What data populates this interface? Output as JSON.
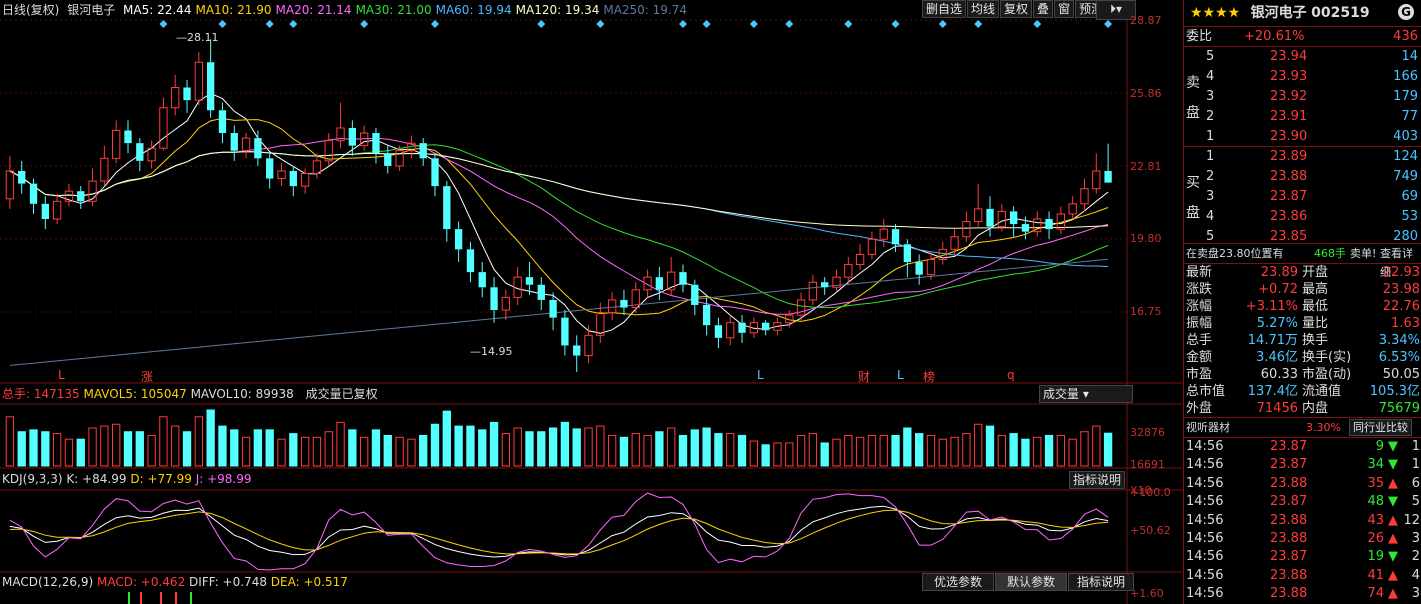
{
  "stock": {
    "stars": "★★★★",
    "name": "银河电子",
    "code": "002519"
  },
  "main_legend": {
    "title": "日线(复权)",
    "name": "银河电子",
    "ma": [
      {
        "label": "MA5: 22.44",
        "color": "#ffffff"
      },
      {
        "label": "MA10: 21.90",
        "color": "#ffd200"
      },
      {
        "label": "MA20: 21.14",
        "color": "#ff66ff"
      },
      {
        "label": "MA30: 21.00",
        "color": "#33dd33"
      },
      {
        "label": "MA60: 19.94",
        "color": "#4cb8ff"
      },
      {
        "label": "MA120: 19.34",
        "color": "#ffffcc"
      },
      {
        "label": "MA250: 19.74",
        "color": "#5a7a99"
      }
    ]
  },
  "toolbar": [
    {
      "label": "删自选"
    },
    {
      "label": "均线"
    },
    {
      "label": "复权"
    },
    {
      "label": "叠"
    },
    {
      "label": "窗"
    },
    {
      "label": "预测"
    }
  ],
  "price_axis": [
    "28.87",
    "25.86",
    "22.81",
    "19.80",
    "16.75"
  ],
  "annotations": {
    "high": "28.11",
    "low": "14.95"
  },
  "event_markers": [
    {
      "label": "L",
      "color": "#ff3b3b"
    },
    {
      "label": "涨",
      "color": "#ff3b3b"
    },
    {
      "label": "L",
      "color": "#4cc6ff"
    },
    {
      "label": "财",
      "color": "#ff3b3b"
    },
    {
      "label": "L",
      "color": "#4cc6ff"
    },
    {
      "label": "榜",
      "color": "#ff3b3b"
    },
    {
      "label": "q",
      "color": "#ff3b3b"
    }
  ],
  "volume_legend": {
    "total": "总手: 147135",
    "mavol5": "MAVOL5: 105047",
    "mavol10": "MAVOL10: 89938",
    "note": "成交量已复权",
    "button": "成交量"
  },
  "volume_axis": [
    "32876",
    "16691",
    "X10"
  ],
  "kdj_legend": {
    "name": "KDJ(9,3,3)",
    "k": "K: +84.99",
    "d": "D: +77.99",
    "j": "J: +98.99",
    "button": "指标说明"
  },
  "kdj_axis": [
    "+100.0",
    "+50.62"
  ],
  "macd_legend": {
    "name": "MACD(12,26,9)",
    "macd": "MACD: +0.462",
    "diff": "DIFF: +0.748",
    "dea": "DEA: +0.517",
    "buttons": [
      "优选参数",
      "默认参数",
      "指标说明"
    ]
  },
  "macd_axis": [
    "+1.60"
  ],
  "quote": {
    "weibi_label": "委比",
    "weibi_value": "+20.61%",
    "weibi_diff": "436",
    "sell_label": [
      "卖",
      "盘"
    ],
    "buy_label": [
      "买",
      "盘"
    ],
    "sell": [
      {
        "lvl": "5",
        "price": "23.94",
        "vol": "14"
      },
      {
        "lvl": "4",
        "price": "23.93",
        "vol": "166"
      },
      {
        "lvl": "3",
        "price": "23.92",
        "vol": "179"
      },
      {
        "lvl": "2",
        "price": "23.91",
        "vol": "77"
      },
      {
        "lvl": "1",
        "price": "23.90",
        "vol": "403"
      }
    ],
    "buy": [
      {
        "lvl": "1",
        "price": "23.89",
        "vol": "124"
      },
      {
        "lvl": "2",
        "price": "23.88",
        "vol": "749"
      },
      {
        "lvl": "3",
        "price": "23.87",
        "vol": "69"
      },
      {
        "lvl": "4",
        "price": "23.86",
        "vol": "53"
      },
      {
        "lvl": "5",
        "price": "23.85",
        "vol": "280"
      }
    ],
    "notice_a": "在卖盘23.80位置有",
    "notice_b": "468手",
    "notice_c": "卖单!",
    "notice_link": "查看详细",
    "stats": [
      {
        "l1": "最新",
        "v1": "23.89",
        "c1": "red",
        "l2": "开盘",
        "v2": "22.93",
        "c2": "red"
      },
      {
        "l1": "涨跌",
        "v1": "+0.72",
        "c1": "red",
        "l2": "最高",
        "v2": "23.98",
        "c2": "red"
      },
      {
        "l1": "涨幅",
        "v1": "+3.11%",
        "c1": "red",
        "l2": "最低",
        "v2": "22.76",
        "c2": "red"
      },
      {
        "l1": "振幅",
        "v1": "5.27%",
        "c1": "cyan",
        "l2": "量比",
        "v2": "1.63",
        "c2": "red"
      },
      {
        "l1": "总手",
        "v1": "14.71万",
        "c1": "cyan",
        "l2": "换手",
        "v2": "3.34%",
        "c2": "cyan"
      },
      {
        "l1": "金额",
        "v1": "3.46亿",
        "c1": "cyan",
        "l2": "换手(实)",
        "v2": "6.53%",
        "c2": "cyan"
      },
      {
        "l1": "市盈",
        "v1": "60.33",
        "c1": "white",
        "l2": "市盈(动)",
        "v2": "50.05",
        "c2": "white"
      },
      {
        "l1": "总市值",
        "v1": "137.4亿",
        "c1": "cyan",
        "l2": "流通值",
        "v2": "105.3亿",
        "c2": "cyan"
      },
      {
        "l1": "外盘",
        "v1": "71456",
        "c1": "red",
        "l2": "内盘",
        "v2": "75679",
        "c2": "green"
      }
    ],
    "industry": {
      "name": "视听器材",
      "pct": "3.30%",
      "button": "同行业比较"
    },
    "ticks": [
      {
        "time": "14:56",
        "price": "23.87",
        "vol": "9",
        "dir": "down",
        "n": "1"
      },
      {
        "time": "14:56",
        "price": "23.87",
        "vol": "34",
        "dir": "down",
        "n": "1"
      },
      {
        "time": "14:56",
        "price": "23.88",
        "vol": "35",
        "dir": "up",
        "n": "6"
      },
      {
        "time": "14:56",
        "price": "23.87",
        "vol": "48",
        "dir": "down",
        "n": "5"
      },
      {
        "time": "14:56",
        "price": "23.88",
        "vol": "43",
        "dir": "up",
        "n": "12"
      },
      {
        "time": "14:56",
        "price": "23.88",
        "vol": "26",
        "dir": "up",
        "n": "3"
      },
      {
        "time": "14:56",
        "price": "23.87",
        "vol": "19",
        "dir": "down",
        "n": "2"
      },
      {
        "time": "14:56",
        "price": "23.88",
        "vol": "41",
        "dir": "up",
        "n": "4"
      },
      {
        "time": "14:56",
        "price": "23.88",
        "vol": "74",
        "dir": "up",
        "n": "3"
      }
    ]
  },
  "chart_data": {
    "type": "candlestick",
    "ylim": [
      14.95,
      28.87
    ],
    "candles": [
      [
        21.8,
        22.9,
        23.5,
        21.4
      ],
      [
        22.9,
        22.4,
        23.3,
        22.0
      ],
      [
        22.4,
        21.6,
        22.6,
        21.2
      ],
      [
        21.6,
        21.0,
        21.9,
        20.6
      ],
      [
        21.0,
        21.7,
        22.0,
        20.8
      ],
      [
        21.7,
        22.1,
        22.4,
        21.5
      ],
      [
        22.1,
        21.7,
        22.3,
        21.4
      ],
      [
        21.7,
        22.5,
        23.0,
        21.5
      ],
      [
        22.5,
        23.4,
        23.9,
        22.3
      ],
      [
        23.4,
        24.5,
        24.9,
        23.2
      ],
      [
        24.5,
        24.0,
        24.9,
        23.6
      ],
      [
        24.0,
        23.3,
        24.2,
        22.9
      ],
      [
        23.3,
        23.8,
        24.1,
        23.0
      ],
      [
        23.8,
        25.4,
        25.8,
        23.7
      ],
      [
        25.4,
        26.2,
        26.7,
        25.1
      ],
      [
        26.2,
        25.7,
        26.5,
        25.2
      ],
      [
        25.7,
        27.2,
        27.6,
        25.5
      ],
      [
        27.2,
        25.3,
        28.11,
        25.0
      ],
      [
        25.3,
        24.4,
        25.6,
        24.0
      ],
      [
        24.4,
        23.7,
        24.7,
        23.3
      ],
      [
        23.7,
        24.2,
        24.4,
        23.4
      ],
      [
        24.2,
        23.4,
        24.5,
        23.1
      ],
      [
        23.4,
        22.6,
        23.6,
        22.2
      ],
      [
        22.6,
        22.9,
        23.2,
        22.3
      ],
      [
        22.9,
        22.3,
        23.1,
        21.9
      ],
      [
        22.3,
        22.8,
        23.0,
        22.0
      ],
      [
        22.8,
        23.3,
        23.6,
        22.6
      ],
      [
        23.3,
        24.1,
        24.4,
        23.1
      ],
      [
        24.1,
        24.6,
        25.6,
        23.8
      ],
      [
        24.6,
        23.9,
        24.9,
        23.5
      ],
      [
        23.9,
        24.4,
        24.7,
        23.7
      ],
      [
        24.4,
        23.6,
        24.6,
        23.2
      ],
      [
        23.6,
        23.1,
        23.9,
        22.8
      ],
      [
        23.1,
        23.7,
        23.9,
        22.9
      ],
      [
        23.7,
        24.0,
        24.3,
        23.4
      ],
      [
        24.0,
        23.4,
        24.2,
        23.1
      ],
      [
        23.4,
        22.3,
        23.6,
        21.9
      ],
      [
        22.3,
        20.6,
        22.5,
        20.1
      ],
      [
        20.6,
        19.8,
        20.9,
        19.3
      ],
      [
        19.8,
        18.9,
        20.1,
        18.5
      ],
      [
        18.9,
        18.3,
        19.3,
        17.9
      ],
      [
        18.3,
        17.4,
        18.7,
        16.9
      ],
      [
        17.4,
        17.9,
        18.2,
        17.0
      ],
      [
        17.9,
        18.7,
        19.1,
        17.6
      ],
      [
        18.7,
        18.4,
        19.3,
        18.0
      ],
      [
        18.4,
        17.8,
        18.7,
        17.4
      ],
      [
        17.8,
        17.1,
        18.1,
        16.6
      ],
      [
        17.1,
        16.0,
        17.4,
        15.6
      ],
      [
        16.0,
        15.6,
        16.4,
        14.95
      ],
      [
        15.6,
        16.4,
        16.8,
        15.3
      ],
      [
        16.4,
        17.3,
        17.7,
        16.1
      ],
      [
        17.3,
        17.8,
        18.1,
        17.0
      ],
      [
        17.8,
        17.5,
        18.2,
        17.2
      ],
      [
        17.5,
        18.2,
        18.5,
        17.3
      ],
      [
        18.2,
        18.7,
        19.0,
        17.9
      ],
      [
        18.7,
        18.2,
        19.1,
        17.8
      ],
      [
        18.2,
        18.9,
        19.5,
        18.0
      ],
      [
        18.9,
        18.4,
        19.2,
        18.1
      ],
      [
        18.4,
        17.6,
        18.6,
        17.2
      ],
      [
        17.6,
        16.8,
        17.9,
        16.4
      ],
      [
        16.8,
        16.3,
        17.1,
        15.9
      ],
      [
        16.3,
        16.9,
        17.2,
        16.0
      ],
      [
        16.9,
        16.5,
        17.2,
        16.1
      ],
      [
        16.5,
        16.9,
        17.1,
        16.3
      ],
      [
        16.9,
        16.6,
        17.0,
        16.4
      ],
      [
        16.6,
        16.9,
        17.1,
        16.4
      ],
      [
        16.9,
        17.2,
        17.4,
        16.7
      ],
      [
        17.2,
        17.8,
        18.1,
        17.0
      ],
      [
        17.8,
        18.5,
        18.8,
        17.6
      ],
      [
        18.5,
        18.3,
        18.7,
        18.0
      ],
      [
        18.3,
        18.7,
        19.0,
        18.1
      ],
      [
        18.7,
        19.2,
        19.5,
        18.4
      ],
      [
        19.2,
        19.6,
        20.0,
        19.0
      ],
      [
        19.6,
        20.2,
        20.5,
        19.4
      ],
      [
        20.2,
        20.6,
        21.0,
        19.9
      ],
      [
        20.6,
        20.0,
        20.8,
        19.7
      ],
      [
        20.0,
        19.3,
        20.2,
        18.7
      ],
      [
        19.3,
        18.8,
        19.6,
        18.4
      ],
      [
        18.8,
        19.4,
        19.7,
        18.6
      ],
      [
        19.4,
        19.8,
        20.1,
        19.2
      ],
      [
        19.8,
        20.3,
        20.6,
        19.6
      ],
      [
        20.3,
        20.9,
        21.3,
        20.1
      ],
      [
        20.9,
        21.4,
        22.4,
        20.7
      ],
      [
        21.4,
        20.7,
        21.9,
        20.3
      ],
      [
        20.7,
        21.3,
        21.6,
        20.5
      ],
      [
        21.3,
        20.8,
        21.5,
        20.3
      ],
      [
        20.8,
        20.5,
        21.1,
        20.2
      ],
      [
        20.5,
        21.0,
        21.3,
        20.3
      ],
      [
        21.0,
        20.6,
        21.3,
        20.2
      ],
      [
        20.6,
        21.2,
        21.5,
        20.4
      ],
      [
        21.2,
        21.6,
        21.9,
        21.0
      ],
      [
        21.6,
        22.2,
        22.6,
        21.3
      ],
      [
        22.2,
        22.9,
        23.6,
        22.0
      ],
      [
        22.9,
        22.44,
        23.98,
        22.76
      ]
    ]
  }
}
